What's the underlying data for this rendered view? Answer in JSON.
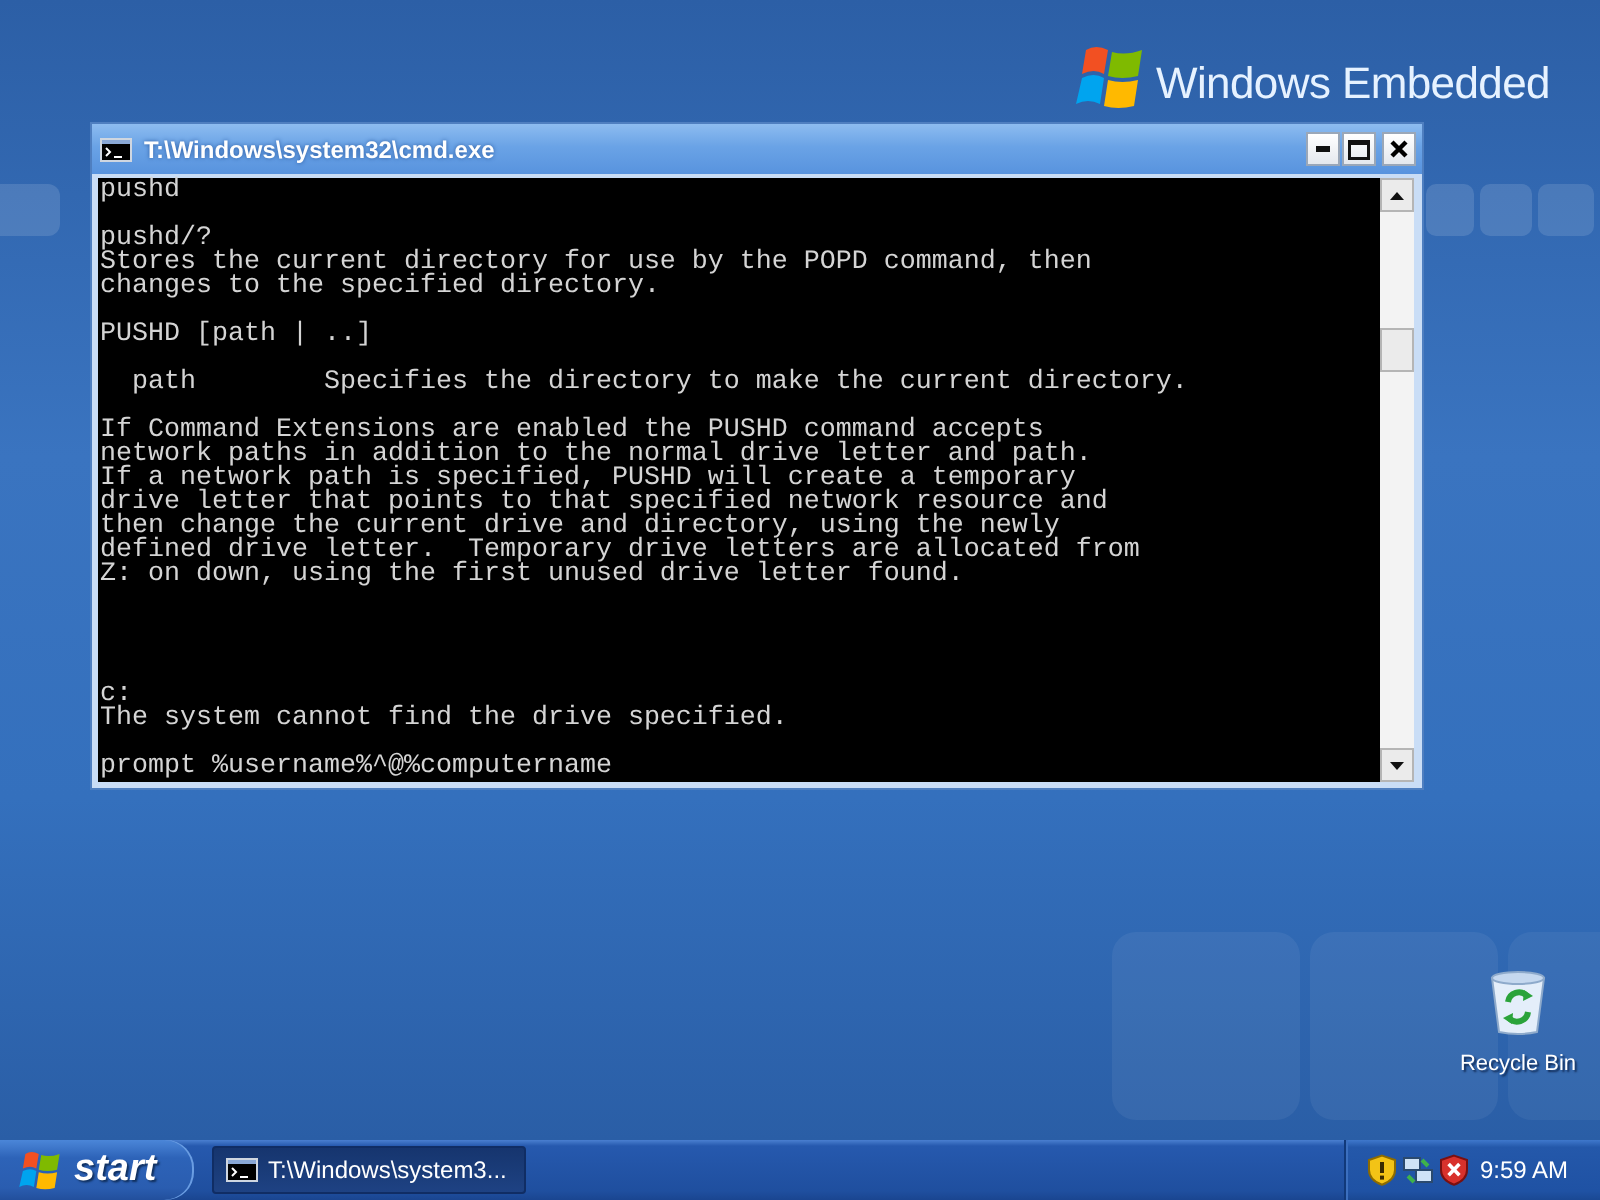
{
  "desktop": {
    "logo": {
      "text": "Windows Embedded"
    },
    "icons": [
      {
        "label": "Recycle Bin"
      }
    ]
  },
  "window": {
    "title": "T:\\Windows\\system32\\cmd.exe",
    "console": {
      "earlier_output": [
        [
          "pushd"
        ],
        [
          "pushd/?",
          "Stores the current directory for use by the POPD command, then",
          "changes to the specified directory."
        ],
        [
          "PUSHD [path | ..]"
        ],
        [
          "  path        Specifies the directory to make the current directory."
        ],
        [
          "If Command Extensions are enabled the PUSHD command accepts",
          "network paths in addition to the normal drive letter and path.",
          "If a network path is specified, PUSHD will create a temporary",
          "drive letter that points to that specified network resource and",
          "then change the current drive and directory, using the newly",
          "defined drive letter.  Temporary drive letters are allocated from",
          "Z: on down, using the first unused drive letter found."
        ]
      ],
      "latest_output": [
        [
          "c:",
          "The system cannot find the drive specified."
        ],
        [
          "prompt %username%^@%computername"
        ]
      ]
    }
  },
  "taskbar": {
    "start_label": "start",
    "tasks": [
      {
        "label": "T:\\Windows\\system3...",
        "selected": true
      }
    ],
    "clock": "9:59 AM"
  }
}
